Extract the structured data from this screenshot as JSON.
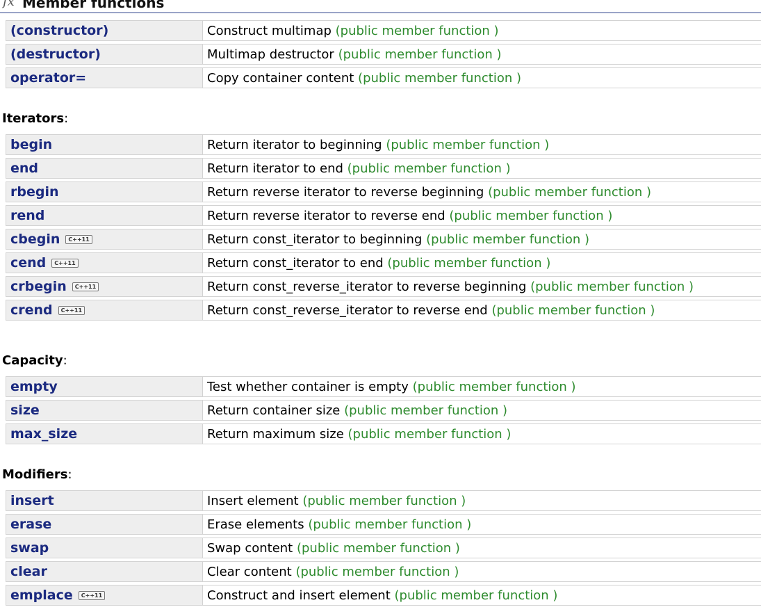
{
  "header": {
    "fx_icon": "fx",
    "title": "Member functions"
  },
  "sections": [
    {
      "label": "",
      "rows": [
        {
          "name": "(constructor)",
          "badge": "",
          "description": "Construct multimap",
          "kind": "(public member function )"
        },
        {
          "name": "(destructor)",
          "badge": "",
          "description": "Multimap destructor",
          "kind": "(public member function )"
        },
        {
          "name": "operator=",
          "badge": "",
          "description": "Copy container content",
          "kind": "(public member function )"
        }
      ]
    },
    {
      "label": "Iterators",
      "rows": [
        {
          "name": "begin",
          "badge": "",
          "description": "Return iterator to beginning",
          "kind": "(public member function )"
        },
        {
          "name": "end",
          "badge": "",
          "description": "Return iterator to end",
          "kind": "(public member function )"
        },
        {
          "name": "rbegin",
          "badge": "",
          "description": "Return reverse iterator to reverse beginning",
          "kind": "(public member function )"
        },
        {
          "name": "rend",
          "badge": "",
          "description": "Return reverse iterator to reverse end",
          "kind": "(public member function )"
        },
        {
          "name": "cbegin",
          "badge": "C++11",
          "description": "Return const_iterator to beginning",
          "kind": "(public member function )"
        },
        {
          "name": "cend",
          "badge": "C++11",
          "description": "Return const_iterator to end",
          "kind": "(public member function )"
        },
        {
          "name": "crbegin",
          "badge": "C++11",
          "description": "Return const_reverse_iterator to reverse beginning",
          "kind": "(public member function )"
        },
        {
          "name": "crend",
          "badge": "C++11",
          "description": "Return const_reverse_iterator to reverse end",
          "kind": "(public member function )"
        }
      ]
    },
    {
      "label": "Capacity",
      "rows": [
        {
          "name": "empty",
          "badge": "",
          "description": "Test whether container is empty",
          "kind": "(public member function )"
        },
        {
          "name": "size",
          "badge": "",
          "description": "Return container size",
          "kind": "(public member function )"
        },
        {
          "name": "max_size",
          "badge": "",
          "description": "Return maximum size",
          "kind": "(public member function )"
        }
      ]
    },
    {
      "label": "Modifiers",
      "rows": [
        {
          "name": "insert",
          "badge": "",
          "description": "Insert element",
          "kind": "(public member function )"
        },
        {
          "name": "erase",
          "badge": "",
          "description": "Erase elements",
          "kind": "(public member function )"
        },
        {
          "name": "swap",
          "badge": "",
          "description": "Swap content",
          "kind": "(public member function )"
        },
        {
          "name": "clear",
          "badge": "",
          "description": "Clear content",
          "kind": "(public member function )"
        },
        {
          "name": "emplace",
          "badge": "C++11",
          "description": "Construct and insert element",
          "kind": "(public member function )"
        }
      ]
    }
  ],
  "colors": {
    "link": "#1b2a80",
    "kind": "#2e8b2e",
    "name_cell_bg": "#eeeeee",
    "border": "#d3d3d3"
  }
}
